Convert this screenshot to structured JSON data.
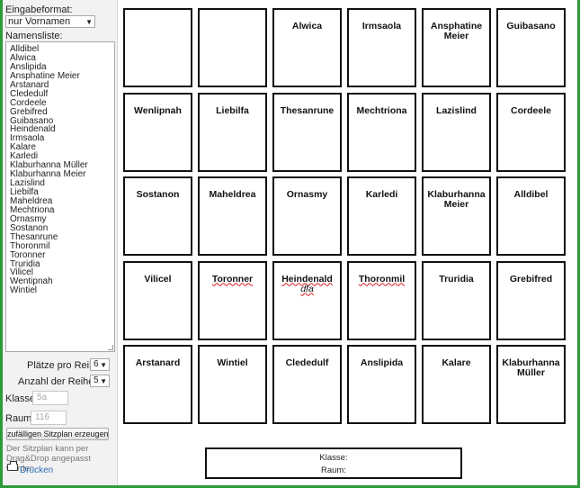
{
  "sidebar": {
    "format_label": "Eingabeformat:",
    "format_value": "nur Vornamen",
    "list_label": "Namensliste:",
    "names": [
      "Alldibel",
      "Alwica",
      "Anslipida",
      "Ansphatine Meier",
      "Arstanard",
      "Clededulf",
      "Cordeele",
      "Grebifred",
      "Guibasano",
      "Heindenald",
      "Irmsaola",
      "Kalare",
      "Karledi",
      "Klaburhanna Müller",
      "Klaburhanna Meier",
      "Lazislind",
      "Liebilfa",
      "Maheldrea",
      "Mechtriona",
      "Ornasmy",
      "Sostanon",
      "Thesanrune",
      "Thoronmil",
      "Toronner",
      "Truridia",
      "Vilicel",
      "Wentipnah",
      "Wintiel"
    ],
    "seats_per_row_label": "Plätze pro Reihe:",
    "seats_per_row_value": "6",
    "rows_label": "Anzahl der Reihen:",
    "rows_value": "5",
    "class_label": "Klasse:",
    "class_placeholder": "5a",
    "room_label": "Raum:",
    "room_placeholder": "116",
    "generate_button": "zufälligen Sitzplan erzeugen",
    "hint": "Der Sitzplan kann per Drag&Drop angepasst werden",
    "print_label": "Drucken"
  },
  "seats": [
    [
      {
        "name": ""
      },
      {
        "name": ""
      },
      {
        "name": "Alwica"
      },
      {
        "name": "Irmsaola"
      },
      {
        "name": "Ansphatine Meier"
      },
      {
        "name": "Guibasano"
      }
    ],
    [
      {
        "name": "Wenlipnah"
      },
      {
        "name": "Liebilfa"
      },
      {
        "name": "Thesanrune"
      },
      {
        "name": "Mechtriona"
      },
      {
        "name": "Lazislind"
      },
      {
        "name": "Cordeele"
      }
    ],
    [
      {
        "name": "Sostanon"
      },
      {
        "name": "Maheldrea"
      },
      {
        "name": "Ornasmy"
      },
      {
        "name": "Karledi"
      },
      {
        "name": "Klaburhanna Meier"
      },
      {
        "name": "Alldibel"
      }
    ],
    [
      {
        "name": "Vilicel"
      },
      {
        "name": "Toronner",
        "marked": true
      },
      {
        "name": "Heindenald",
        "marked": true,
        "sub": "dfa"
      },
      {
        "name": "Thoronmil",
        "marked": true
      },
      {
        "name": "Truridia"
      },
      {
        "name": "Grebifred"
      }
    ],
    [
      {
        "name": "Arstanard"
      },
      {
        "name": "Wintiel"
      },
      {
        "name": "Clededulf"
      },
      {
        "name": "Anslipida"
      },
      {
        "name": "Kalare"
      },
      {
        "name": "Klaburhanna Müller"
      }
    ]
  ],
  "info": {
    "class_label": "Klasse:",
    "room_label": "Raum:"
  }
}
